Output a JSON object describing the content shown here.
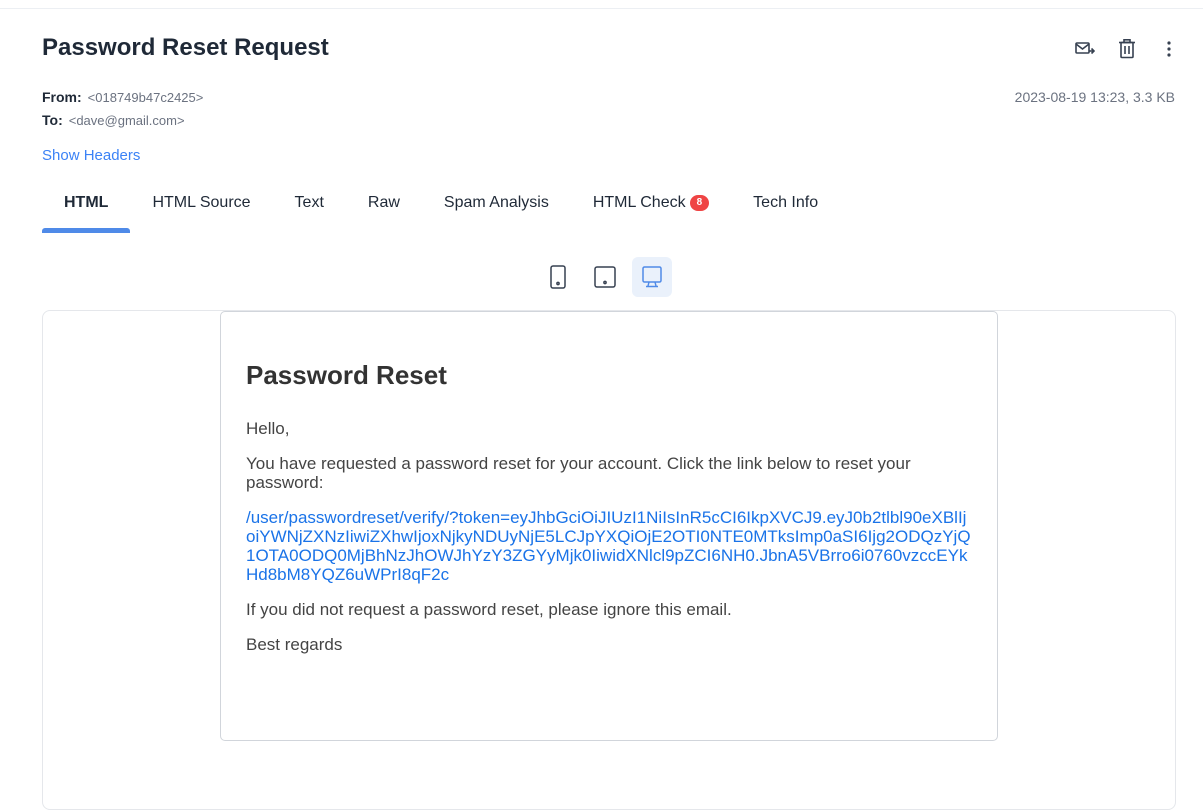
{
  "email": {
    "subject": "Password Reset Request",
    "from_label": "From:",
    "from_value": "<018749b47c2425>",
    "to_label": "To:",
    "to_value": "<dave@gmail.com>",
    "date_size": "2023-08-19 13:23, 3.3 KB",
    "show_headers": "Show Headers"
  },
  "actions": {
    "icons": [
      "forward-mail-icon",
      "trash-icon",
      "more-vertical-icon"
    ]
  },
  "tabs": [
    {
      "label": "HTML",
      "active": true
    },
    {
      "label": "HTML Source"
    },
    {
      "label": "Text"
    },
    {
      "label": "Raw"
    },
    {
      "label": "Spam Analysis"
    },
    {
      "label": "HTML Check",
      "badge": "8"
    },
    {
      "label": "Tech Info"
    }
  ],
  "devices": [
    {
      "name": "mobile",
      "icon": "phone-icon"
    },
    {
      "name": "tablet",
      "icon": "tablet-icon"
    },
    {
      "name": "desktop",
      "icon": "desktop-icon",
      "active": true
    }
  ],
  "body": {
    "heading": "Password Reset",
    "greeting": "Hello,",
    "intro": "You have requested a password reset for your account. Click the link below to reset your password:",
    "link": "/user/passwordreset/verify/?token=eyJhbGciOiJIUzI1NiIsInR5cCI6IkpXVCJ9.eyJ0b2tlbl90eXBlIjoiYWNjZXNzIiwiZXhwIjoxNjkyNDUyNjE5LCJpYXQiOjE2OTI0NTE0MTksImp0aSI6Ijg2ODQzYjQ1OTA0ODQ0MjBhNzJhOWJhYzY3ZGYyMjk0IiwidXNlcl9pZCI6NH0.JbnA5VBrro6i0760vzccEYkHd8bM8YQZ6uWPrI8qF2c",
    "ignore_note": "If you did not request a password reset, please ignore this email.",
    "signoff": "Best regards"
  },
  "colors": {
    "accent": "#4f8ae8",
    "link": "#1a73e8",
    "badge": "#ef4444"
  }
}
